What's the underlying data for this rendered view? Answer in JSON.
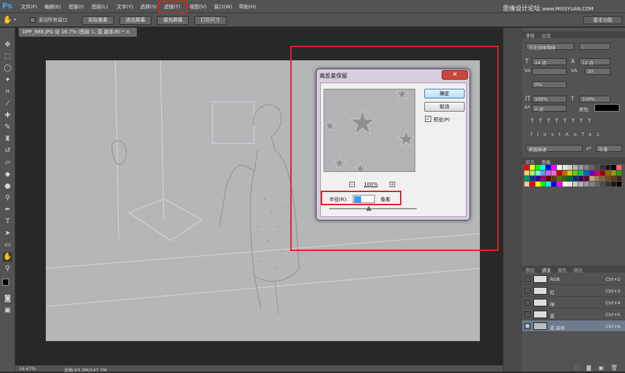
{
  "menubar": {
    "logo": "Ps",
    "items": [
      "文件(F)",
      "编辑(E)",
      "图像(I)",
      "图层(L)",
      "文字(Y)",
      "选择(S)",
      "滤镜(T)",
      "视图(V)",
      "窗口(W)",
      "帮助(H)"
    ],
    "watermark_main": "思缘设计论坛",
    "watermark_url": "www.MISSYUAN.COM"
  },
  "options": {
    "scroll_all": "滚动所有窗口",
    "buttons": [
      "实际像素",
      "适合屏幕",
      "填充屏幕",
      "打印尺寸"
    ],
    "workspace": "基本功能"
  },
  "document": {
    "tab_title": "DPP_988.JPG @ 16.7% (图层 1, 蓝 副本/8) *",
    "zoom": "16.67%",
    "doc_size": "文档:63.3M/147.7M"
  },
  "dialog": {
    "title": "高反差保留",
    "ok": "确定",
    "cancel": "取消",
    "preview_label": "预览(P)",
    "preview_checked": true,
    "zoom": "100%",
    "radius_label": "半径(R):",
    "radius_value": "10",
    "radius_unit": "像素",
    "slider_value": 0.45
  },
  "character_panel": {
    "tabs": [
      "字符",
      "段落"
    ],
    "font_family": "方正剑体简体",
    "font_style": "-",
    "size": "24 点",
    "leading": "12 点",
    "tracking": "20",
    "kerning": "",
    "scale_pct": "0%",
    "vscale": "100%",
    "hscale": "100%",
    "baseline": "0 点",
    "color_label": "颜色:",
    "language": "美国英语",
    "antialias": "平滑"
  },
  "swatches_panel": {
    "tabs": [
      "颜色",
      "色板"
    ]
  },
  "layers_panel": {
    "tabs": [
      "图层",
      "通道",
      "属性",
      "路径"
    ],
    "channels": [
      {
        "name": "RGB",
        "shortcut": "Ctrl+2",
        "visible": false,
        "active": false
      },
      {
        "name": "红",
        "shortcut": "Ctrl+3",
        "visible": false,
        "active": false
      },
      {
        "name": "绿",
        "shortcut": "Ctrl+4",
        "visible": false,
        "active": false
      },
      {
        "name": "蓝",
        "shortcut": "Ctrl+5",
        "visible": false,
        "active": false
      },
      {
        "name": "蓝 副本",
        "shortcut": "Ctrl+6",
        "visible": true,
        "active": true
      }
    ]
  },
  "colors": {
    "highlight_red": "#dd2222",
    "panel_bg": "#535353"
  }
}
